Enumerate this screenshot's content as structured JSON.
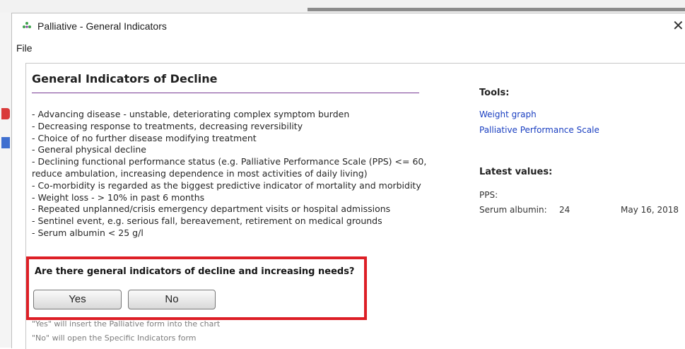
{
  "window": {
    "title": "Palliative - General Indicators",
    "close_glyph": "✕"
  },
  "menubar": {
    "file": "File"
  },
  "main": {
    "heading": "General Indicators of Decline",
    "indicators": [
      "- Advancing disease - unstable, deteriorating complex symptom burden",
      "- Decreasing response to treatments, decreasing reversibility",
      "- Choice of no further disease modifying treatment",
      "- General physical decline",
      "- Declining functional performance status (e.g. Palliative Performance Scale (PPS) <= 60,",
      "reduce ambulation, increasing dependence in most activities of daily living)",
      "- Co-morbidity is regarded as the biggest predictive indicator of mortality and morbidity",
      "- Weight loss - > 10% in past 6 months",
      "- Repeated unplanned/crisis emergency department visits or hospital admissions",
      "- Sentinel event, e.g. serious fall, bereavement, retirement on medical grounds",
      "- Serum albumin < 25 g/l"
    ],
    "question": "Are there general indicators of decline and increasing needs?",
    "yes_label": "Yes",
    "no_label": "No",
    "hint_yes": "\"Yes\" will insert the Palliative form into the chart",
    "hint_no": "\"No\" will open the Specific Indicators form"
  },
  "sidebar": {
    "tools_heading": "Tools:",
    "tools": [
      "Weight graph",
      "Palliative Performance Scale"
    ],
    "latest_heading": "Latest values:",
    "pps_label": "PPS:",
    "albumin_label": "Serum albumin:",
    "albumin_value": "24",
    "albumin_date": "May 16, 2018"
  },
  "colors": {
    "highlight_border": "#dd1f26",
    "rule": "#7a3c96",
    "link": "#1a3fc1"
  }
}
